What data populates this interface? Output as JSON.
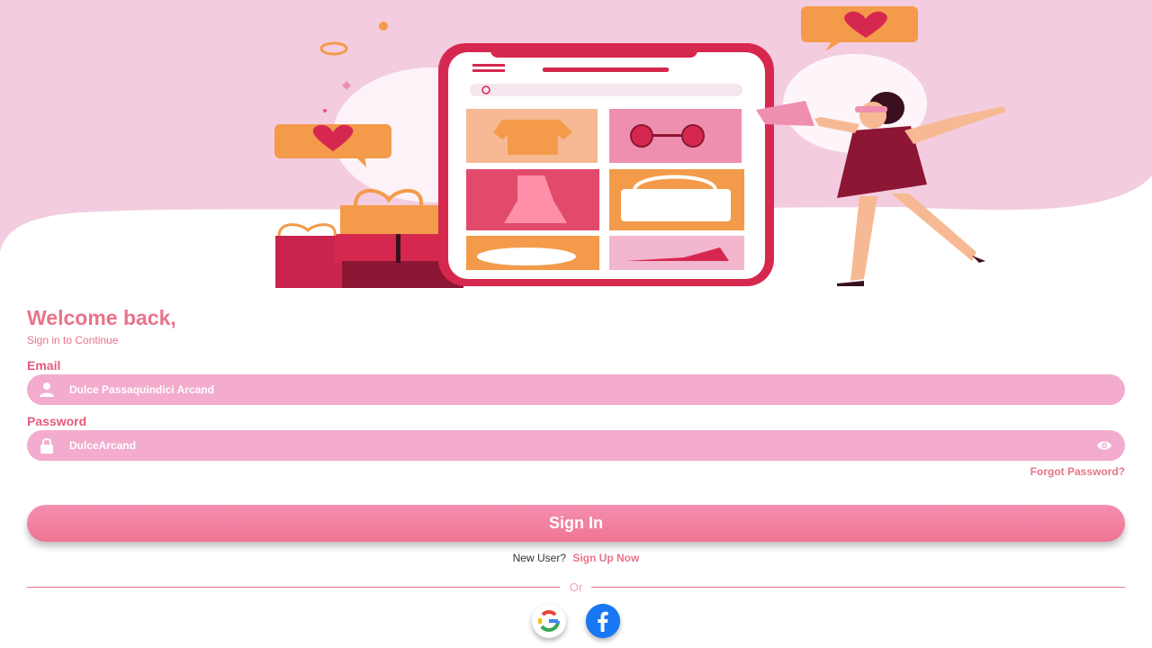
{
  "hero": {
    "illustration": "online-shopping-illustration"
  },
  "login": {
    "welcome": "Welcome back,",
    "subtitle": "Sign in to Continue",
    "email": {
      "label": "Email",
      "value": "Dulce Passaquindici Arcand",
      "icon": "user-icon"
    },
    "password": {
      "label": "Password",
      "value": "DulceArcand",
      "icon": "lock-icon",
      "toggle_icon": "eye-icon"
    },
    "forgot_password": "Forgot Password?",
    "sign_in_label": "Sign In",
    "new_user_text": "New User?",
    "sign_up_label": "Sign Up Now",
    "divider_text": "Or",
    "social": [
      "google-icon",
      "facebook-icon"
    ]
  },
  "colors": {
    "accent": "#e9738a",
    "field_bg": "#f3accd",
    "hero_bg": "#f3ccdf",
    "button_top": "#f58fb0",
    "button_bottom": "#ef7492"
  }
}
